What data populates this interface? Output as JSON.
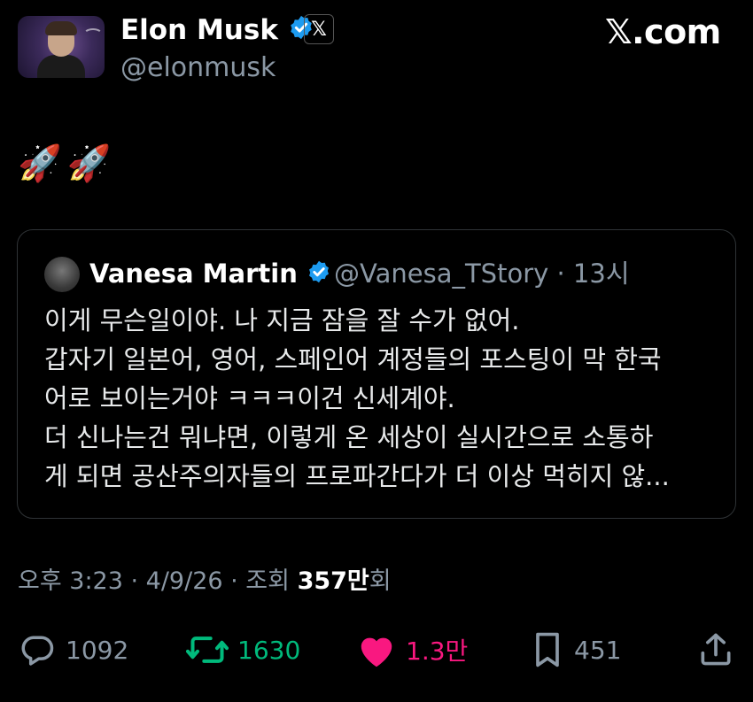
{
  "author": {
    "name": "Elon Musk",
    "handle": "@elonmusk",
    "x_badge": "𝕏"
  },
  "site_label": "𝕏.com",
  "post": {
    "emoji": [
      "🚀",
      "🚀"
    ]
  },
  "quote": {
    "name": "Vanesa Martin",
    "handle_time": "@Vanesa_TStory · 13시",
    "lines": [
      "이게 무슨일이야. 나 지금 잠을 잘 수가 없어.",
      "갑자기 일본어, 영어, 스페인어 계정들의 포스팅이 막 한국",
      "어로 보이는거야 ㅋㅋㅋ이건 신세계야.",
      "더 신나는건 뭐냐면, 이렇게 온 세상이 실시간으로 소통하",
      "게 되면 공산주의자들의 프로파간다가 더 이상 먹히지 않..."
    ]
  },
  "meta": {
    "prefix": "오후 3:23 · 4/9/26 · 조회 ",
    "views": "357만",
    "suffix": "회"
  },
  "actions": {
    "replies": "1092",
    "reposts": "1630",
    "likes": "1.3만",
    "bookmarks": "451"
  },
  "colors": {
    "background": "#000000",
    "verified": "#1d9bf0",
    "repost": "#00ba7c",
    "like": "#f91880",
    "muted": "#8b98a5"
  }
}
